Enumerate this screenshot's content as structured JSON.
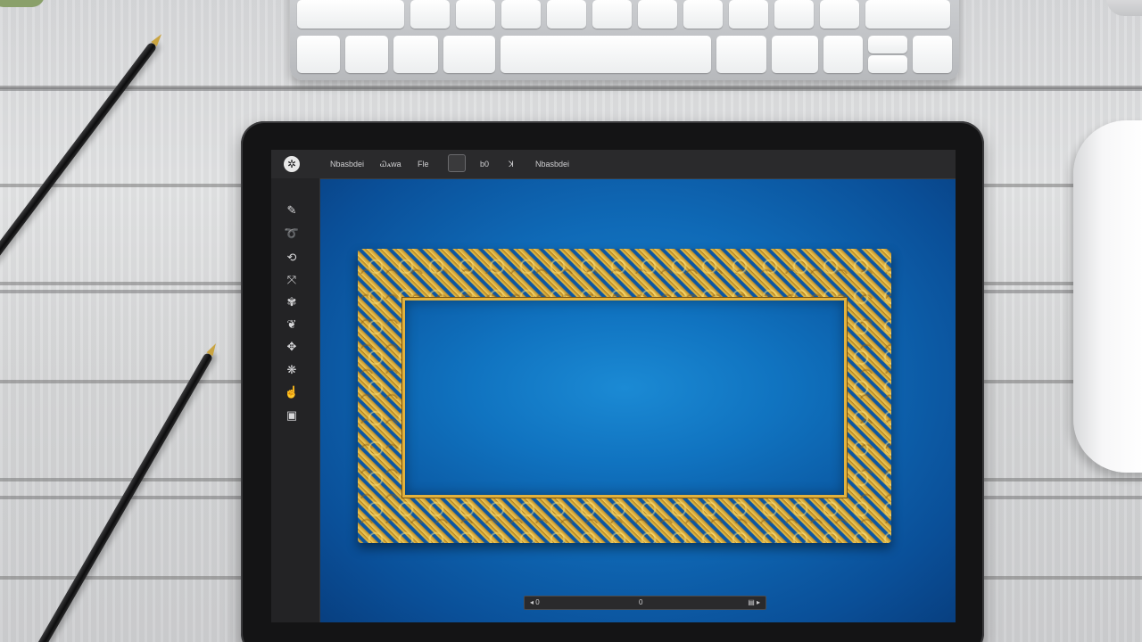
{
  "app": {
    "menu": [
      {
        "label": "Nbasbdei"
      },
      {
        "label": "Ꮗꭺwa"
      },
      {
        "label": "Fle"
      },
      {
        "label": "b0"
      },
      {
        "label": "ꓘ"
      },
      {
        "label": "Nbasbdei"
      }
    ],
    "logo_icon": "✲",
    "tools": [
      {
        "name": "pen-tool-icon",
        "glyph": "✎"
      },
      {
        "name": "lasso-tool-icon",
        "glyph": "➰"
      },
      {
        "name": "transform-tool-icon",
        "glyph": "⟲"
      },
      {
        "name": "node-tool-icon",
        "glyph": "⤧"
      },
      {
        "name": "pattern-tool-icon",
        "glyph": "✾"
      },
      {
        "name": "shape-tool-icon",
        "glyph": "❦"
      },
      {
        "name": "brush-tool-icon",
        "glyph": "✥"
      },
      {
        "name": "filter-tool-icon",
        "glyph": "❋"
      },
      {
        "name": "hand-tool-icon",
        "glyph": "☝"
      },
      {
        "name": "layer-tool-icon",
        "glyph": "▣"
      }
    ],
    "bottom_bar": {
      "left": "◂ 0",
      "center": "0",
      "right": "▤ ▸"
    }
  },
  "colors": {
    "canvas_blue": "#0f6ab7",
    "frame_gold": "#d8ad3b",
    "ui_dark": "#232325"
  }
}
